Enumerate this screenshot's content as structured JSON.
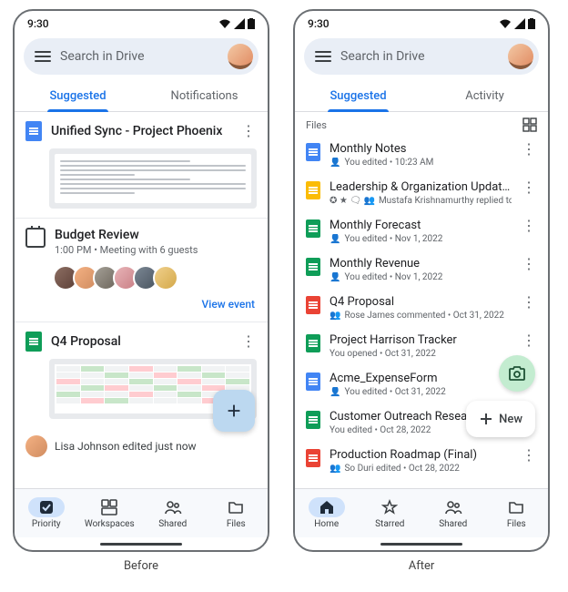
{
  "status": {
    "time": "9:30"
  },
  "search": {
    "placeholder": "Search in Drive"
  },
  "before": {
    "tabs": [
      "Suggested",
      "Notifications"
    ],
    "card1": {
      "title": "Unified Sync - Project Phoenix"
    },
    "meeting": {
      "title": "Budget Review",
      "sub": "1:00 PM • Meeting with 6 guests",
      "link": "View event"
    },
    "card2": {
      "title": "Q4 Proposal"
    },
    "edit": {
      "text": "Lisa Johnson edited just now"
    },
    "nav": [
      "Priority",
      "Workspaces",
      "Shared",
      "Files"
    ]
  },
  "after": {
    "tabs": [
      "Suggested",
      "Activity"
    ],
    "section": "Files",
    "files": [
      {
        "type": "blue",
        "title": "Monthly Notes",
        "sub": "You edited • 10:23 AM",
        "icon": "person"
      },
      {
        "type": "yellow",
        "title": "Leadership & Organization Updates...",
        "sub": "Mustafa Krishnamurthy replied to a…",
        "icon": "starmix"
      },
      {
        "type": "green",
        "title": "Monthly Forecast",
        "sub": "You edited • Nov 1, 2022",
        "icon": "person"
      },
      {
        "type": "green",
        "title": "Monthly Revenue",
        "sub": "You edited • Nov 1, 2022",
        "icon": "person"
      },
      {
        "type": "red",
        "title": "Q4 Proposal",
        "sub": "Rose James commented • Oct 31, 2022",
        "icon": "people"
      },
      {
        "type": "green",
        "title": "Project Harrison Tracker",
        "sub": "You opened • Oct 31, 2022",
        "icon": ""
      },
      {
        "type": "blue",
        "title": "Acme_ExpenseForm",
        "sub": "You edited • Oct 31, 2022",
        "icon": "person"
      },
      {
        "type": "green",
        "title": "Customer Outreach Research",
        "sub": "You edited • Oct 28, 2022",
        "icon": ""
      },
      {
        "type": "red",
        "title": "Production Roadmap (Final)",
        "sub": "So Duri edited • Oct 28, 2022",
        "icon": "people"
      }
    ],
    "newLabel": "New",
    "nav": [
      "Home",
      "Starred",
      "Shared",
      "Files"
    ]
  },
  "captions": {
    "before": "Before",
    "after": "After"
  }
}
